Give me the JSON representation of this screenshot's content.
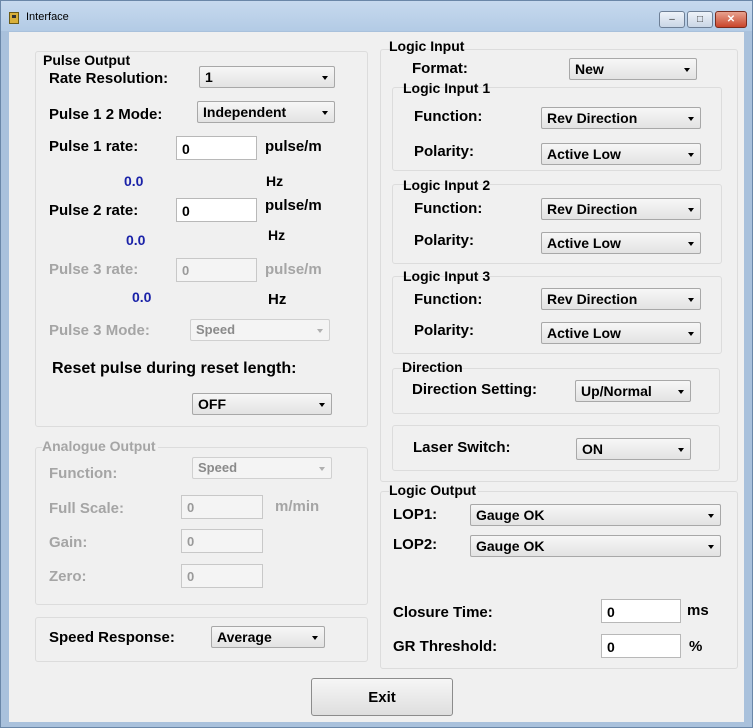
{
  "window": {
    "title": "Interface"
  },
  "pulse_output": {
    "title": "Pulse Output",
    "rate_resolution_label": "Rate Resolution:",
    "rate_resolution_value": "1",
    "mode12_label": "Pulse 1 2 Mode:",
    "mode12_value": "Independent",
    "p1_label": "Pulse 1 rate:",
    "p1_value": "0",
    "p1_unit": "pulse/m",
    "p1_hz": "0.0",
    "p2_label": "Pulse 2 rate:",
    "p2_value": "0",
    "p2_unit": "pulse/m",
    "p2_hz": "0.0",
    "p3_label": "Pulse 3 rate:",
    "p3_value": "0",
    "p3_unit": "pulse/m",
    "p3_hz": "0.0",
    "hz_unit": "Hz",
    "mode3_label": "Pulse 3 Mode:",
    "mode3_value": "Speed",
    "reset_label": "Reset pulse during reset length:",
    "reset_value": "OFF"
  },
  "analogue_output": {
    "title": "Analogue Output",
    "function_label": "Function:",
    "function_value": "Speed",
    "full_scale_label": "Full Scale:",
    "full_scale_value": "0",
    "full_scale_unit": "m/min",
    "gain_label": "Gain:",
    "gain_value": "0",
    "zero_label": "Zero:",
    "zero_value": "0"
  },
  "speed_response": {
    "label": "Speed Response:",
    "value": "Average"
  },
  "logic_input": {
    "title": "Logic Input",
    "format_label": "Format:",
    "format_value": "New",
    "function_label": "Function:",
    "polarity_label": "Polarity:",
    "inputs": [
      {
        "title": "Logic Input 1",
        "function": "Rev Direction",
        "polarity": "Active Low"
      },
      {
        "title": "Logic Input 2",
        "function": "Rev Direction",
        "polarity": "Active Low"
      },
      {
        "title": "Logic Input 3",
        "function": "Rev Direction",
        "polarity": "Active Low"
      }
    ]
  },
  "direction": {
    "title": "Direction",
    "label": "Direction Setting:",
    "value": "Up/Normal"
  },
  "laser_switch": {
    "label": "Laser Switch:",
    "value": "ON"
  },
  "logic_output": {
    "title": "Logic Output",
    "lop1_label": "LOP1:",
    "lop1_value": "Gauge OK",
    "lop2_label": "LOP2:",
    "lop2_value": "Gauge OK",
    "closure_label": "Closure Time:",
    "closure_value": "0",
    "closure_unit": "ms",
    "gr_label": "GR Threshold:",
    "gr_value": "0",
    "gr_unit": "%"
  },
  "exit_label": "Exit"
}
